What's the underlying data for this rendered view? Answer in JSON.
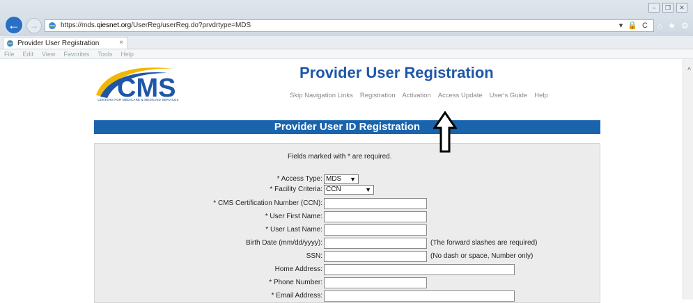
{
  "browser": {
    "url_prefix": "https://mds.",
    "url_host": "qiesnet.org",
    "url_path": "/UserReg/userReg.do?prvdrtype=MDS",
    "tab_title": "Provider User Registration",
    "tab_close": "×",
    "menu": [
      "File",
      "Edit",
      "View",
      "Favorites",
      "Tools",
      "Help"
    ],
    "addr_right": "▾ 🔒 C",
    "back_glyph": "←",
    "fwd_glyph": "→",
    "chrome_icons": [
      "⌂",
      "★",
      "⚙"
    ],
    "window_buttons": [
      "–",
      "❐",
      "✕"
    ],
    "scroll_up": "^"
  },
  "header": {
    "logo_text": "CMS",
    "logo_subtext": "CENTERS FOR MEDICARE & MEDICAID SERVICES",
    "title": "Provider User Registration",
    "nav": [
      "Skip Navigation Links",
      "Registration",
      "Activation",
      "Access Update",
      "User's Guide",
      "Help"
    ]
  },
  "section": {
    "title": "Provider User ID Registration",
    "required_note": "Fields marked with * are required."
  },
  "form": {
    "access_type_label": "* Access Type:",
    "access_type_value": "MDS",
    "facility_criteria_label": "* Facility Criteria:",
    "facility_criteria_value": "CCN",
    "ccn_label": "* CMS Certification Number (CCN):",
    "first_name_label": "* User First Name:",
    "last_name_label": "* User Last Name:",
    "birth_date_label": "Birth Date (mm/dd/yyyy):",
    "birth_date_hint": "(The forward slashes are required)",
    "ssn_label": "SSN:",
    "ssn_hint": "(No dash or space, Number only)",
    "home_address_label": "Home Address:",
    "phone_label": "* Phone Number:",
    "email_label": "* Email Address:"
  },
  "colors": {
    "brand_blue": "#1e57a8",
    "bar_blue": "#1a64ad",
    "logo_gold": "#f2b705"
  },
  "icons": {
    "select_arrow": "▼"
  }
}
